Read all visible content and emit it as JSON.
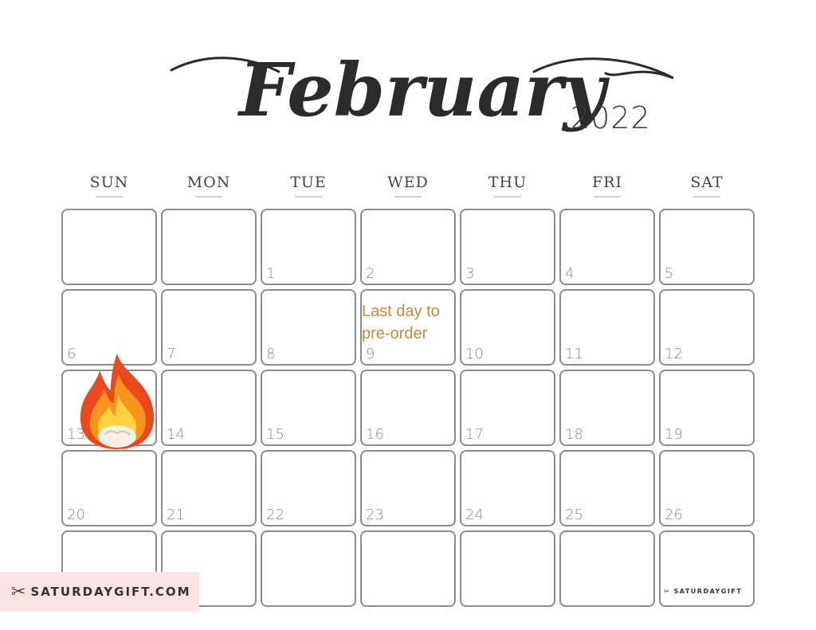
{
  "header": {
    "month": "February",
    "year": "2022"
  },
  "weekdays": [
    "SUN",
    "MON",
    "TUE",
    "WED",
    "THU",
    "FRI",
    "SAT"
  ],
  "days": [
    "",
    "",
    "1",
    "2",
    "3",
    "4",
    "5",
    "6",
    "7",
    "8",
    "9",
    "10",
    "11",
    "12",
    "13",
    "14",
    "15",
    "16",
    "17",
    "18",
    "19",
    "20",
    "21",
    "22",
    "23",
    "24",
    "25",
    "26",
    "",
    "",
    "",
    "",
    "",
    "",
    ""
  ],
  "events": {
    "wed_9": [
      "Last day to",
      "pre-order"
    ]
  },
  "sticker": {
    "icon": "fire-icon",
    "day": "13"
  },
  "branding": {
    "banner_text": "SATURDAYGIFT.COM",
    "corner_text": "SATURDAYGIFT"
  },
  "colors": {
    "event_text": "#c8893a",
    "cell_border": "#8c8c8c",
    "banner_bg": "#fbe3e3"
  }
}
